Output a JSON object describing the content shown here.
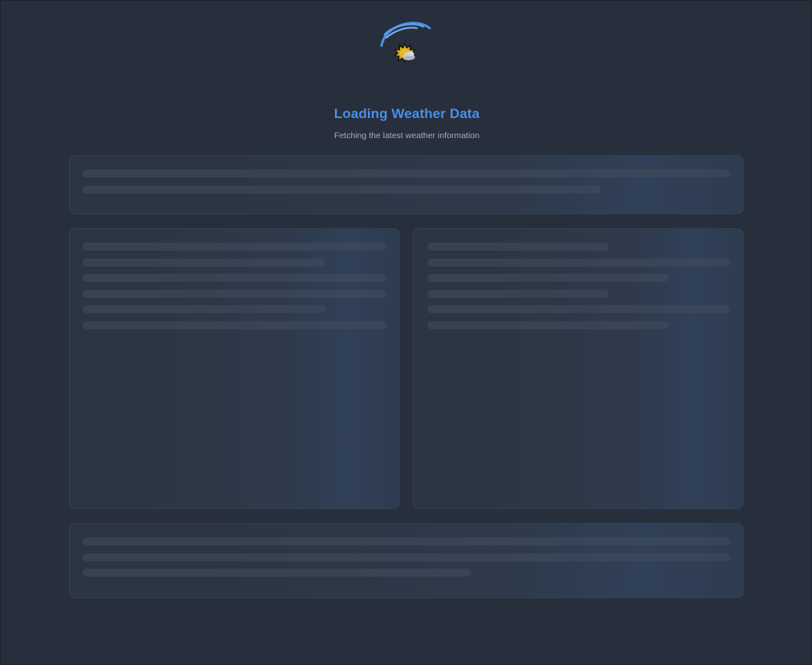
{
  "loader": {
    "spinner_icon": "loading-spinner-arcs",
    "weather_icon": "sun-behind-cloud-icon",
    "title": "Loading Weather Data",
    "subtitle": "Fetching the latest weather information"
  },
  "colors": {
    "background": "#262f3b",
    "accent": "#4b8fe6",
    "subtitle": "#a4adb9",
    "card_border": "#33404f",
    "skeleton_bar": "#3b4654"
  }
}
